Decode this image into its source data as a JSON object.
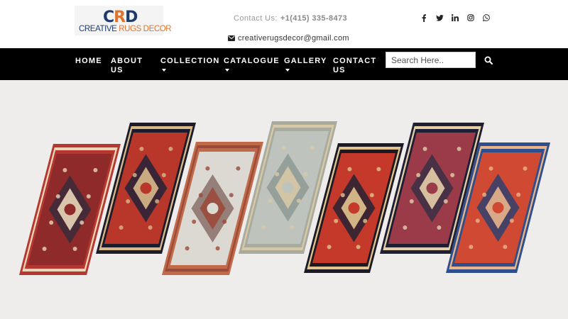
{
  "brand": {
    "logo_mark": [
      "C",
      "R",
      "D"
    ],
    "logo_words": [
      "CREATIVE ",
      "RUGS DECOR"
    ]
  },
  "contact": {
    "label": "Contact Us:",
    "phone": "+1(415) 335-8473",
    "email": "creativerugsdecor@gmail.com"
  },
  "social_icons": [
    "facebook-icon",
    "twitter-icon",
    "linkedin-icon",
    "instagram-icon",
    "whatsapp-icon"
  ],
  "nav": {
    "items": [
      {
        "label": "HOME",
        "dropdown": false
      },
      {
        "label": "ABOUT US",
        "dropdown": false
      },
      {
        "label": "COLLECTION",
        "dropdown": true
      },
      {
        "label": "CATALOGUE",
        "dropdown": true
      },
      {
        "label": "GALLERY",
        "dropdown": true
      },
      {
        "label": "CONTACT US",
        "dropdown": false
      }
    ],
    "search_placeholder": "Search Here.."
  },
  "colors": {
    "nav_bg": "#000000",
    "hero_bg": "#efedec",
    "brand_navy": "#1f3b6e",
    "brand_orange": "#e0742a"
  },
  "hero": {
    "rugs": [
      {
        "field": "#8e2b2a",
        "border": "#b6372f",
        "accent": "#e9d6b8",
        "medallion": "#3b2a3a"
      },
      {
        "field": "#b8362a",
        "border": "#1d1c2a",
        "accent": "#d9b98a",
        "medallion": "#23223a"
      },
      {
        "field": "#dcd8d2",
        "border": "#c06a4a",
        "accent": "#9a4a3a",
        "medallion": "#8a6f6a"
      },
      {
        "field": "#bfc3bd",
        "border": "#a9ab9f",
        "accent": "#d7c9a6",
        "medallion": "#8d9a95"
      },
      {
        "field": "#c4392a",
        "border": "#1c1b25",
        "accent": "#e2c48e",
        "medallion": "#262334"
      },
      {
        "field": "#9b3a48",
        "border": "#1e1f33",
        "accent": "#e4cfa9",
        "medallion": "#3a2f45"
      },
      {
        "field": "#d04a33",
        "border": "#2e4f8e",
        "accent": "#e9b48a",
        "medallion": "#2e3f6e"
      }
    ]
  }
}
